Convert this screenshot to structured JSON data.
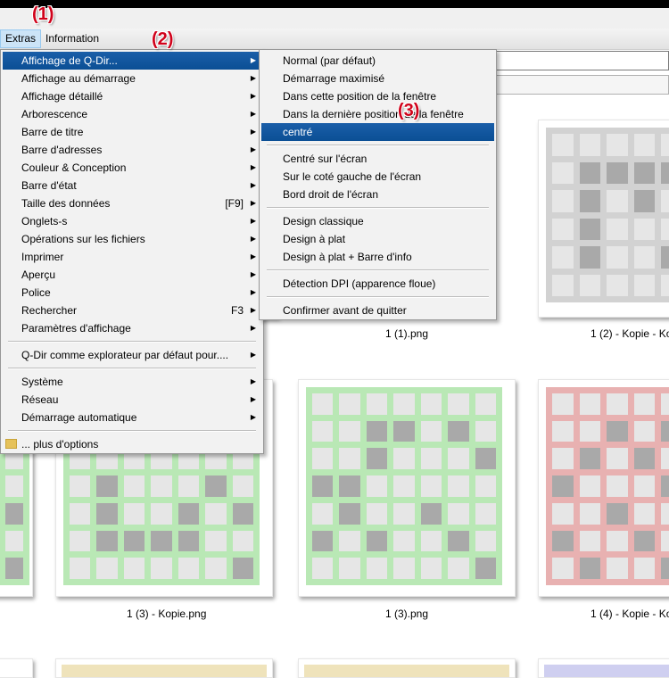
{
  "menubar": {
    "extras": "Extras",
    "information": "Information"
  },
  "badges": {
    "b1": "(1)",
    "b2": "(2)",
    "b3": "(3)"
  },
  "colors": {
    "highlight": "#0b4f95",
    "green": "#b9e8b5",
    "red": "#e8b1b1",
    "gray": "#d2d2d2",
    "cell_light": "#e6e6e6",
    "cell_dark": "#a9a9a9"
  },
  "main_menu": {
    "items": [
      {
        "label": "Affichage de Q-Dir...",
        "arrow": "▶"
      },
      {
        "label": "Affichage au démarrage",
        "arrow": "▶"
      },
      {
        "label": "Affichage détaillé",
        "arrow": "▶"
      },
      {
        "label": "Arborescence",
        "arrow": "▶"
      },
      {
        "label": "Barre de titre",
        "arrow": "▶"
      },
      {
        "label": "Barre d'adresses",
        "arrow": "▶"
      },
      {
        "label": "Couleur & Conception",
        "arrow": "▶"
      },
      {
        "label": "Barre d'état",
        "arrow": "▶"
      },
      {
        "label": "Taille des données",
        "shortcut": "[F9]",
        "arrow": "▶"
      },
      {
        "label": "Onglets-s",
        "arrow": "▶"
      },
      {
        "label": "Opérations sur les fichiers",
        "arrow": "▶"
      },
      {
        "label": "Imprimer",
        "arrow": "▶"
      },
      {
        "label": "Aperçu",
        "arrow": "▶"
      },
      {
        "label": "Police",
        "arrow": "▶"
      },
      {
        "label": "Rechercher",
        "shortcut": "F3",
        "arrow": "▶"
      },
      {
        "label": "Paramètres d'affichage",
        "arrow": "▶"
      },
      {
        "label": "Q-Dir comme explorateur par défaut pour....",
        "arrow": "▶"
      },
      {
        "label": "Système",
        "arrow": "▶"
      },
      {
        "label": "Réseau",
        "arrow": "▶"
      },
      {
        "label": "Démarrage automatique",
        "arrow": "▶"
      },
      {
        "label": "... plus d'options"
      }
    ]
  },
  "sub_menu": {
    "items": [
      {
        "label": "Normal (par défaut)"
      },
      {
        "label": "Démarrage maximisé"
      },
      {
        "label": "Dans cette position de la fenêtre"
      },
      {
        "label": "Dans la dernière position de la fenêtre"
      },
      {
        "label": "centré"
      },
      {
        "label": "Centré sur l'écran"
      },
      {
        "label": "Sur le coté gauche de l'écran"
      },
      {
        "label": "Bord droit de l'écran"
      },
      {
        "label": "Design classique"
      },
      {
        "label": "Design à plat"
      },
      {
        "label": "Design à plat + Barre d'info"
      },
      {
        "label": "Détection DPI (apparence floue)"
      },
      {
        "label": "Confirmer avant de quitter"
      }
    ]
  },
  "files": {
    "f1": "1 (1).png",
    "f2": "1 (2) - Kopie - Ko",
    "f3": "1 (3) - Kopie.png",
    "f4": "1 (3).png",
    "f5": "1 (4) - Kopie - Ko"
  }
}
